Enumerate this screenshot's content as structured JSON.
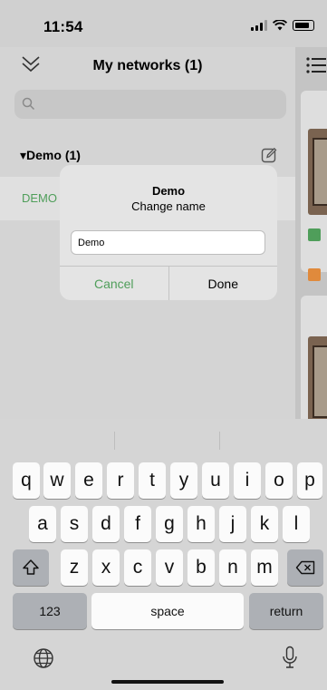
{
  "status_bar": {
    "time": "11:54"
  },
  "header": {
    "title": "My networks (1)"
  },
  "search": {
    "placeholder": ""
  },
  "groups": [
    {
      "label": "▾Demo (1)"
    }
  ],
  "networks": [
    {
      "label": "DEMO"
    }
  ],
  "dialog": {
    "title": "Demo",
    "message": "Change name",
    "input_value": "Demo",
    "cancel_label": "Cancel",
    "done_label": "Done"
  },
  "keyboard": {
    "row1": [
      "q",
      "w",
      "e",
      "r",
      "t",
      "y",
      "u",
      "i",
      "o",
      "p"
    ],
    "row2": [
      "a",
      "s",
      "d",
      "f",
      "g",
      "h",
      "j",
      "k",
      "l"
    ],
    "row3": [
      "z",
      "x",
      "c",
      "v",
      "b",
      "n",
      "m"
    ],
    "numbers_label": "123",
    "space_label": "space",
    "return_label": "return"
  },
  "colors": {
    "accent_green": "#4f9e5a",
    "orange": "#e08a3c"
  },
  "icons": [
    "double-chevron-down-icon",
    "search-icon",
    "edit-icon",
    "menu-icon",
    "shift-icon",
    "backspace-icon",
    "globe-icon",
    "microphone-icon"
  ]
}
